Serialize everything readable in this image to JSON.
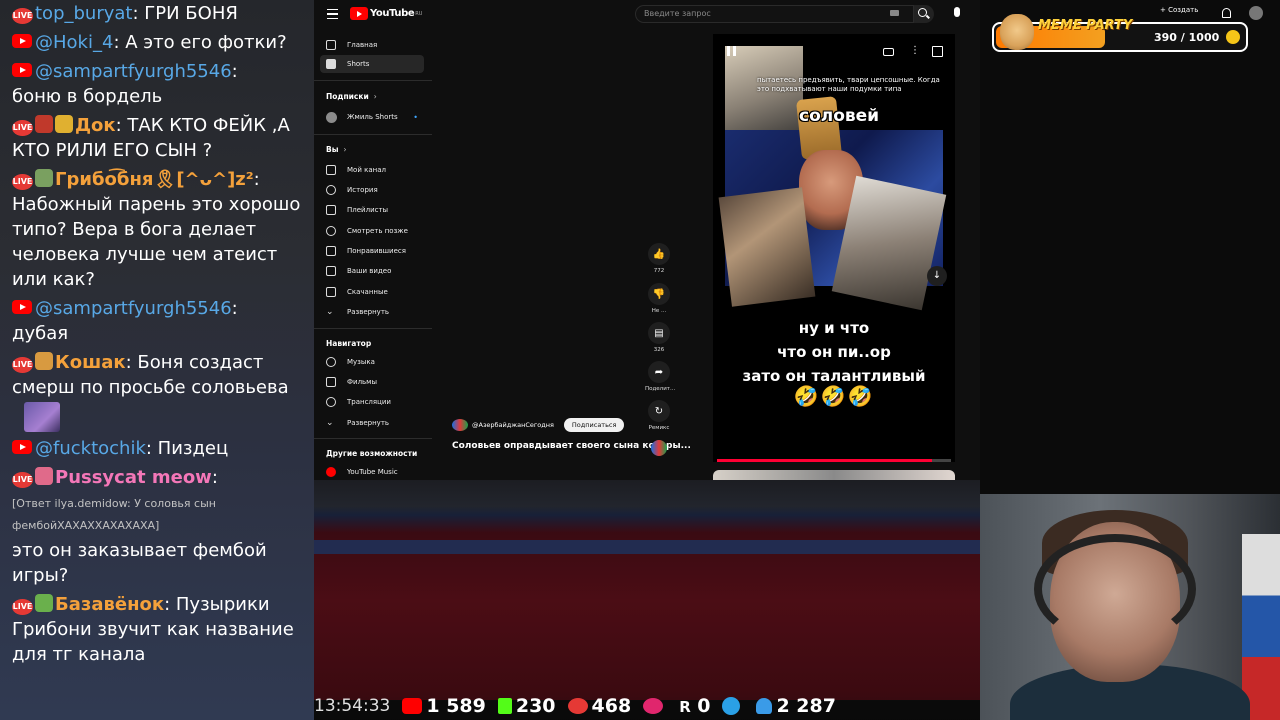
{
  "chat": {
    "messages": [
      {
        "badge": "LIVE",
        "nick": "top_buryat",
        "nick_style": "blue",
        "text": "ГРИ БОНЯ"
      },
      {
        "badge": "YT",
        "nick": "@Hoki_4",
        "nick_style": "blue",
        "text": "А это его фотки?"
      },
      {
        "badge": "YT",
        "nick": "@sampartfyurgh5546",
        "nick_style": "blue",
        "text": "боню в бордель"
      },
      {
        "badge": "LIVE",
        "nick": "Док",
        "nick_style": "orange",
        "text": "ТАК КТО ФЕЙК ,А КТО РИЛИ ЕГО СЫН ?"
      },
      {
        "badge": "LIVE",
        "nick": "Грибо͡бня🎗[^ᴗ^]z²",
        "nick_style": "orange",
        "text": "Набожный парень это хорошо типо? Вера в бога делает человека лучше чем атеист или как?"
      },
      {
        "badge": "YT",
        "nick": "@sampartfyurgh5546",
        "nick_style": "blue",
        "text": "дубая"
      },
      {
        "badge": "LIVE",
        "nick": "Кошак",
        "nick_style": "orange",
        "text": "Боня создаст смерш по просьбе соловьева"
      },
      {
        "badge": "YT",
        "nick": "@fucktochik",
        "nick_style": "blue",
        "text": "Пиздец"
      },
      {
        "badge": "LIVE",
        "nick": "Pussycat meow",
        "nick_style": "pink",
        "text": ""
      },
      {
        "badge": "LIVE",
        "nick": "Базавёнок",
        "nick_style": "orange",
        "text": "Пузырики Грибони звучит как название для тг канала"
      }
    ],
    "reply_line1": "[Ответ ilya.demidow: У соловья сын",
    "reply_line2": "фембойХАХАХХАХАХАХА]",
    "reply_text": "это он заказывает фембой игры?"
  },
  "youtube": {
    "logo_text": "YouTube",
    "logo_region": "RU",
    "search_placeholder": "Введите запрос",
    "create_label": "Создать",
    "sidebar": {
      "main": [
        {
          "label": "Главная",
          "icon": "home-icon"
        },
        {
          "label": "Shorts",
          "icon": "shorts-icon",
          "active": true
        }
      ],
      "subs_header": "Подписки",
      "subs": [
        {
          "label": "Жмиль Shorts"
        }
      ],
      "you_header": "Вы",
      "you": [
        {
          "label": "Мой канал",
          "icon": "channel-icon"
        },
        {
          "label": "История",
          "icon": "history-icon"
        },
        {
          "label": "Плейлисты",
          "icon": "playlists-icon"
        },
        {
          "label": "Смотреть позже",
          "icon": "watch-later-icon"
        },
        {
          "label": "Понравившиеся",
          "icon": "like-icon"
        },
        {
          "label": "Ваши видео",
          "icon": "video-icon"
        },
        {
          "label": "Скачанные",
          "icon": "download-icon"
        },
        {
          "label": "Развернуть",
          "icon": "chevron-down-icon"
        }
      ],
      "nav_header": "Навигатор",
      "nav": [
        {
          "label": "Музыка",
          "icon": "music-icon"
        },
        {
          "label": "Фильмы",
          "icon": "film-icon"
        },
        {
          "label": "Трансляции",
          "icon": "live-icon"
        },
        {
          "label": "Развернуть",
          "icon": "chevron-down-icon"
        }
      ],
      "other_header": "Другие возможности",
      "other": [
        {
          "label": "YouTube Music",
          "icon": "youtube-music-icon"
        }
      ]
    },
    "short": {
      "caption_top": "пытаетесь предъявить, твари цепсошные. Когда это подхватывают наши подумки типа",
      "name_caption": "соловей",
      "bottom_line1": "ну и что",
      "bottom_line2": "что он пи..ор",
      "bottom_line3": "зато он талантливый",
      "emojis": "🤣🤣🤣",
      "progress": 0.92,
      "channel": "@АзербайджанСегодня",
      "subscribe_label": "Подписаться",
      "title": "Соловьев оправдывает своего сына которы..."
    },
    "actions": [
      {
        "icon": "thumbs-up-icon",
        "label": "772"
      },
      {
        "icon": "thumbs-down-icon",
        "label": "Не ..."
      },
      {
        "icon": "comments-icon",
        "label": "326"
      },
      {
        "icon": "share-icon",
        "label": "Поделит..."
      },
      {
        "icon": "remix-icon",
        "label": "Ремикс"
      }
    ]
  },
  "overlay": {
    "meme_title": "MEME PARTY",
    "meme_count": "390 / 1000",
    "meme_progress": 0.39,
    "time": "13:54:33",
    "stats": {
      "youtube": "1 589",
      "kick": "230",
      "live": "468",
      "r": "0",
      "viewers": "2 287"
    }
  },
  "colors": {
    "youtube_red": "#ff0000",
    "nick_orange": "#f4a13b",
    "nick_blue": "#58a8e6",
    "kick_green": "#53fc18"
  }
}
